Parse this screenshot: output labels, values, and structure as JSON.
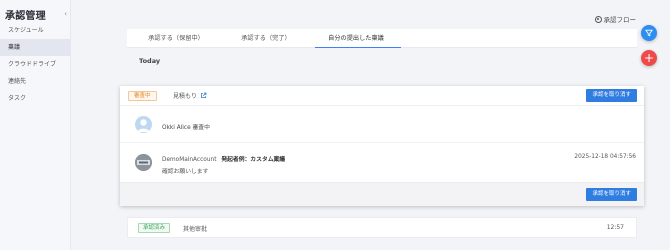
{
  "sidebar": {
    "title": "承認管理",
    "collapse_icon": "chevron-left-icon",
    "items": [
      {
        "label": "スケジュール",
        "active": false
      },
      {
        "label": "稟議",
        "active": true
      },
      {
        "label": "クラウドドライブ",
        "active": false
      },
      {
        "label": "連絡先",
        "active": false
      },
      {
        "label": "タスク",
        "active": false
      }
    ]
  },
  "header": {
    "flow_link": "承認フロー",
    "tabs": [
      {
        "label": "承認する（保留中）",
        "active": false
      },
      {
        "label": "承認する（完了）",
        "active": false
      },
      {
        "label": "自分の提出した稟議",
        "active": true
      }
    ]
  },
  "fabs": {
    "filter_icon": "filter-icon",
    "add_icon": "plus-icon"
  },
  "section": {
    "date_label": "Today"
  },
  "request_card": {
    "status_badge": "審査中",
    "title": "見積もり",
    "link_icon": "external-link-icon",
    "withdraw_top": "承認を取り消す",
    "approver": {
      "name_status": "Okki Alice 審査中"
    },
    "submission": {
      "account": "DemoMainAccount",
      "title": "発起者例：カスタム稟議",
      "timestamp": "2025-12-18 04:57:56",
      "message": "確認お願いします"
    },
    "withdraw_bottom": "承認を取り消す"
  },
  "done_item": {
    "status_badge": "承認済み",
    "title": "其他审批",
    "time": "12:57"
  },
  "colors": {
    "accent": "#2f7de1",
    "danger": "#ef4a4a",
    "pending": "#e08a2b",
    "approved": "#3fa35a"
  }
}
